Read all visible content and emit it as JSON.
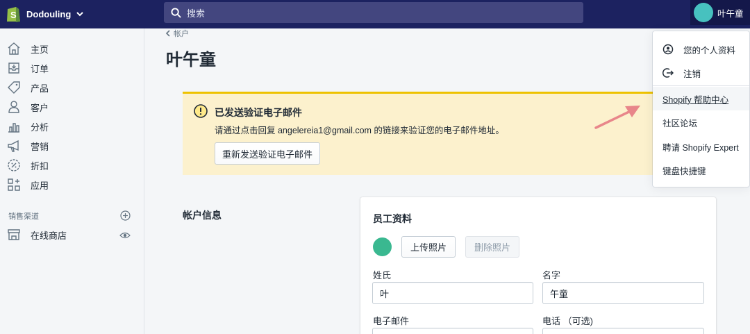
{
  "topbar": {
    "store_name": "Dodouling",
    "search_placeholder": "搜索",
    "user_name": "叶午童"
  },
  "sidebar": {
    "items": [
      {
        "label": "主页",
        "icon": "home-icon"
      },
      {
        "label": "订单",
        "icon": "orders-icon"
      },
      {
        "label": "产品",
        "icon": "tag-icon"
      },
      {
        "label": "客户",
        "icon": "customer-icon"
      },
      {
        "label": "分析",
        "icon": "analytics-icon"
      },
      {
        "label": "营销",
        "icon": "megaphone-icon"
      },
      {
        "label": "折扣",
        "icon": "discount-icon"
      },
      {
        "label": "应用",
        "icon": "apps-icon"
      }
    ],
    "channels_label": "销售渠道",
    "online_store_label": "在线商店"
  },
  "main": {
    "back_label": "帐户",
    "page_title": "叶午童",
    "banner": {
      "title": "已发送验证电子邮件",
      "text": "请通过点击回复 angelereia1@gmail.com 的链接来验证您的电子邮件地址。",
      "button": "重新发送验证电子邮件"
    },
    "section_title": "帐户信息",
    "card": {
      "title": "员工资料",
      "upload_label": "上传照片",
      "delete_label": "删除照片",
      "last_name_label": "姓氏",
      "last_name_value": "叶",
      "first_name_label": "名字",
      "first_name_value": "午童",
      "email_label": "电子邮件",
      "phone_label": "电话 （可选)"
    }
  },
  "dropdown": {
    "items": [
      {
        "label": "您的个人资料",
        "icon": "profile-icon"
      },
      {
        "label": "注销",
        "icon": "logout-icon"
      },
      {
        "label": "Shopify 帮助中心"
      },
      {
        "label": "社区论坛"
      },
      {
        "label": "聘请 Shopify Expert"
      },
      {
        "label": "键盘快捷键"
      }
    ]
  },
  "colors": {
    "topbar": "#1c2260",
    "search": "#43467f",
    "avatar": "#47c1bf",
    "banner_bg": "#fcf1cd",
    "banner_border": "#eec200",
    "profile_avatar": "#3ab890",
    "arrow": "#e8868a"
  }
}
